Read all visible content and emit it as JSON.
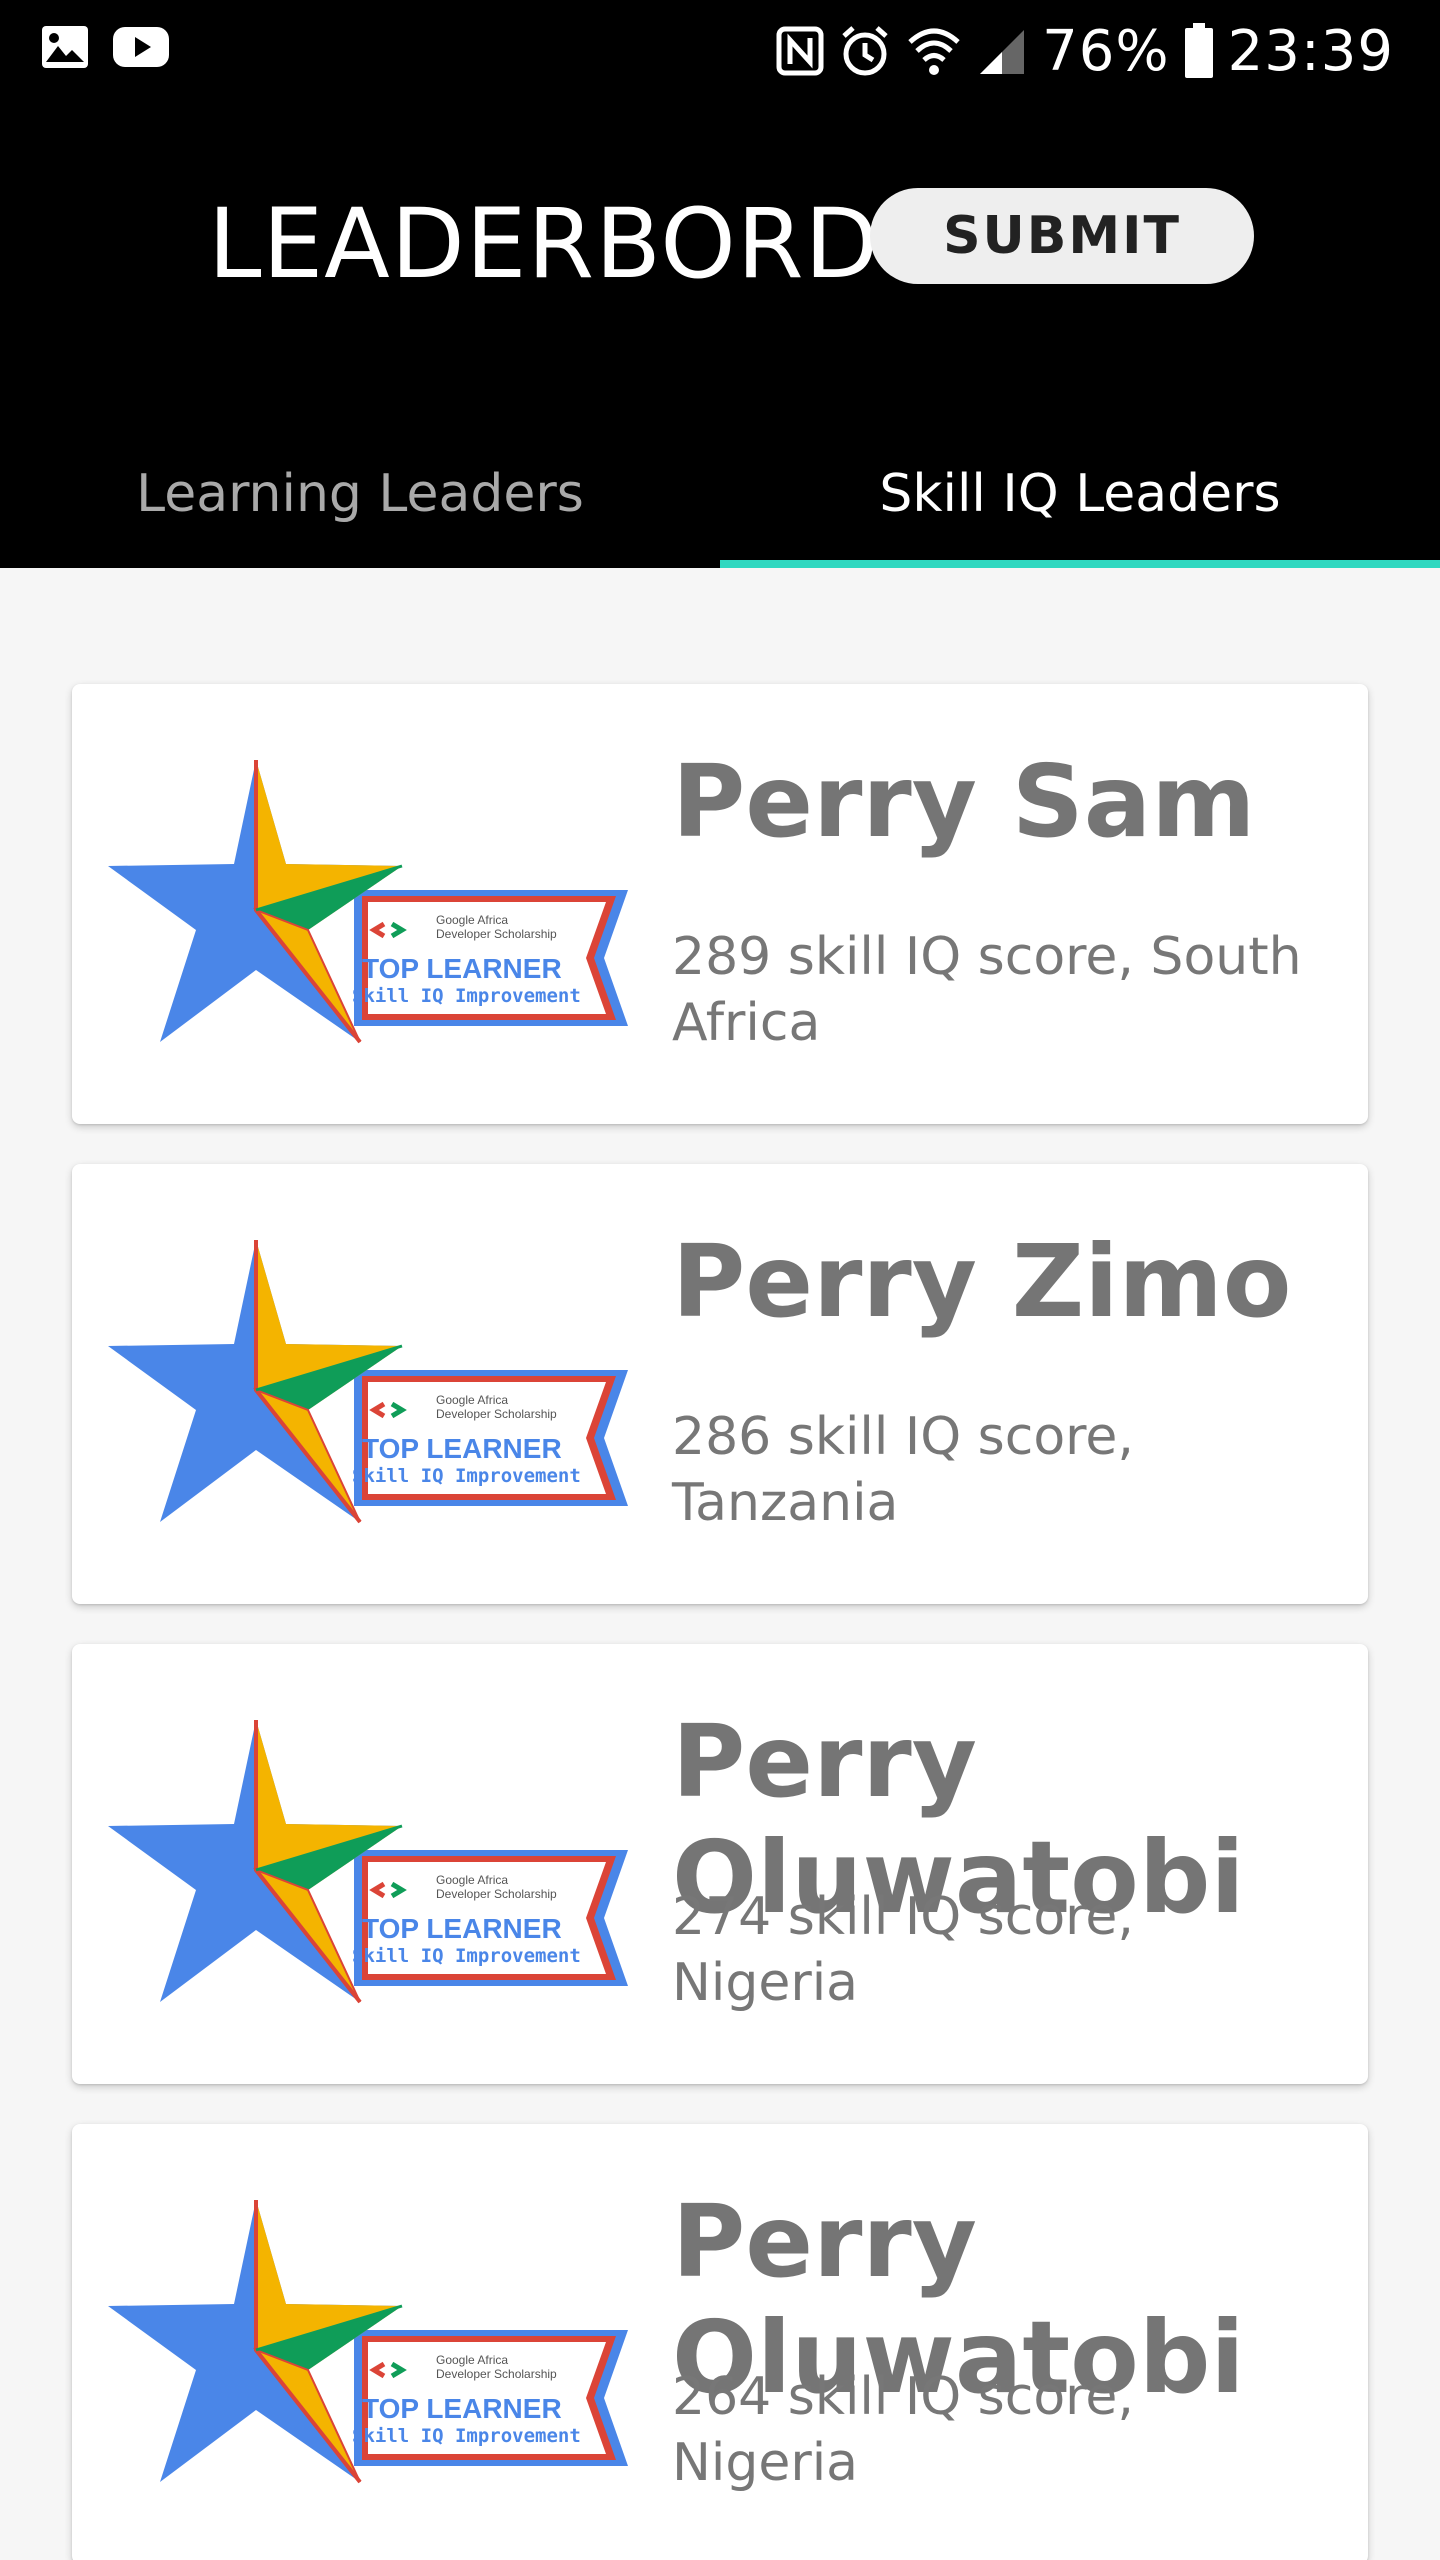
{
  "status_bar": {
    "battery_percent": "76%",
    "time": "23:39"
  },
  "header": {
    "title": "LEADERBORD",
    "submit_label": "SUBMIT"
  },
  "tabs": [
    {
      "label": "Learning Leaders",
      "active": false
    },
    {
      "label": "Skill IQ Leaders",
      "active": true
    }
  ],
  "badge": {
    "org_line1": "Google Africa",
    "org_line2": "Developer Scholarship",
    "title": "TOP LEARNER",
    "subtitle": "Skill IQ Improvement"
  },
  "leaders": [
    {
      "name": "Perry Sam",
      "detail": "289 skill IQ score, South Africa"
    },
    {
      "name": "Perry Zimo",
      "detail": "286 skill IQ score, Tanzania"
    },
    {
      "name": "Perry Oluwatobi",
      "detail": "274 skill IQ score, Nigeria"
    },
    {
      "name": "Perry Oluwatobi",
      "detail": "264 skill IQ score, Nigeria"
    }
  ],
  "colors": {
    "accent": "#2fd8c0",
    "header_bg": "#000000",
    "star_blue": "#4a86e8",
    "star_yellow": "#f4b400",
    "ribbon_red": "#db4437"
  }
}
